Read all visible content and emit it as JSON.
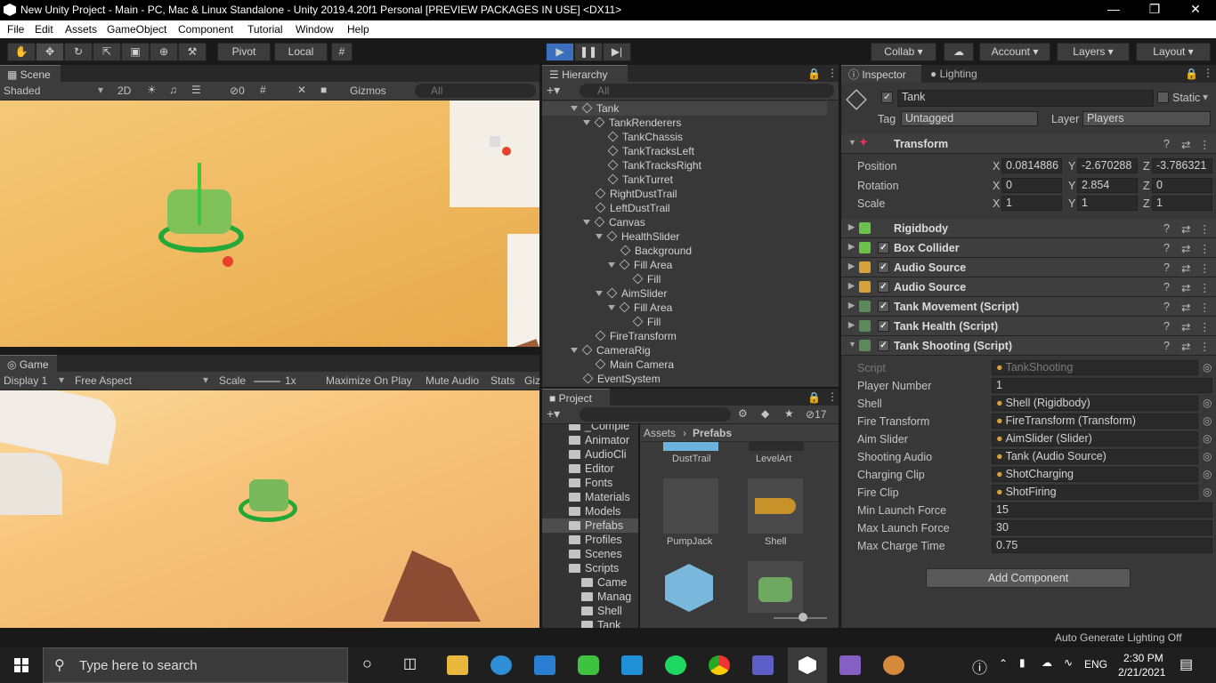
{
  "window": {
    "title": "New Unity Project - Main - PC, Mac & Linux Standalone - Unity 2019.4.20f1 Personal [PREVIEW PACKAGES IN USE] <DX11>"
  },
  "menu": [
    "File",
    "Edit",
    "Assets",
    "GameObject",
    "Component",
    "Tutorial",
    "Window",
    "Help"
  ],
  "toolbar": {
    "pivot": "Pivot",
    "local": "Local",
    "collab": "Collab",
    "account": "Account",
    "layers": "Layers",
    "layout": "Layout"
  },
  "scene": {
    "tab": "Scene",
    "shading": "Shaded",
    "mode2d": "2D",
    "hidden_count": "0",
    "gizmos": "Gizmos",
    "search_placeholder": "All"
  },
  "game": {
    "tab": "Game",
    "display": "Display 1",
    "aspect": "Free Aspect",
    "scale_label": "Scale",
    "scale_value": "1x",
    "maximize": "Maximize On Play",
    "mute": "Mute Audio",
    "stats": "Stats",
    "gizmos": "Giz"
  },
  "hierarchy": {
    "tab": "Hierarchy",
    "search_placeholder": "All",
    "items": [
      {
        "label": "Tank",
        "depth": 0,
        "expanded": true
      },
      {
        "label": "TankRenderers",
        "depth": 1,
        "expanded": true
      },
      {
        "label": "TankChassis",
        "depth": 2
      },
      {
        "label": "TankTracksLeft",
        "depth": 2
      },
      {
        "label": "TankTracksRight",
        "depth": 2
      },
      {
        "label": "TankTurret",
        "depth": 2
      },
      {
        "label": "RightDustTrail",
        "depth": 1
      },
      {
        "label": "LeftDustTrail",
        "depth": 1
      },
      {
        "label": "Canvas",
        "depth": 1,
        "expanded": true
      },
      {
        "label": "HealthSlider",
        "depth": 2,
        "expanded": true
      },
      {
        "label": "Background",
        "depth": 3
      },
      {
        "label": "Fill Area",
        "depth": 3,
        "expanded": true
      },
      {
        "label": "Fill",
        "depth": 4
      },
      {
        "label": "AimSlider",
        "depth": 2,
        "expanded": true
      },
      {
        "label": "Fill Area",
        "depth": 3,
        "expanded": true
      },
      {
        "label": "Fill",
        "depth": 4
      },
      {
        "label": "FireTransform",
        "depth": 1
      },
      {
        "label": "CameraRig",
        "depth": 0,
        "expanded": true
      },
      {
        "label": "Main Camera",
        "depth": 1
      },
      {
        "label": "EventSystem",
        "depth": 0
      }
    ]
  },
  "project": {
    "tab": "Project",
    "hidden_count": "17",
    "breadcrumb_root": "Assets",
    "breadcrumb_current": "Prefabs",
    "folders": [
      "_Comple",
      "Animator",
      "AudioCli",
      "Editor",
      "Fonts",
      "Materials",
      "Models",
      "Prefabs",
      "Profiles",
      "Scenes",
      "Scripts",
      "Came",
      "Manag",
      "Shell",
      "Tank"
    ],
    "assets": [
      "DustTrail",
      "LevelArt",
      "PumpJack",
      "Shell",
      "",
      ""
    ]
  },
  "inspector": {
    "tab": "Inspector",
    "lighting_tab": "Lighting",
    "object_name": "Tank",
    "static_label": "Static",
    "tag_label": "Tag",
    "tag_value": "Untagged",
    "layer_label": "Layer",
    "layer_value": "Players",
    "transform": {
      "title": "Transform",
      "position_label": "Position",
      "rotation_label": "Rotation",
      "scale_label": "Scale",
      "position": {
        "x": "0.0814886",
        "y": "-2.670288",
        "z": "-3.786321"
      },
      "rotation": {
        "x": "0",
        "y": "2.854",
        "z": "0"
      },
      "scale": {
        "x": "1",
        "y": "1",
        "z": "1"
      }
    },
    "components": [
      "Rigidbody",
      "Box Collider",
      "Audio Source",
      "Audio Source",
      "Tank Movement (Script)",
      "Tank Health (Script)",
      "Tank Shooting (Script)"
    ],
    "shooting": [
      {
        "label": "Script",
        "value": "TankShooting"
      },
      {
        "label": "Player Number",
        "value": "1"
      },
      {
        "label": "Shell",
        "value": "Shell (Rigidbody)"
      },
      {
        "label": "Fire Transform",
        "value": "FireTransform (Transform)"
      },
      {
        "label": "Aim Slider",
        "value": "AimSlider (Slider)"
      },
      {
        "label": "Shooting Audio",
        "value": "Tank (Audio Source)"
      },
      {
        "label": "Charging Clip",
        "value": "ShotCharging"
      },
      {
        "label": "Fire Clip",
        "value": "ShotFiring"
      },
      {
        "label": "Min Launch Force",
        "value": "15"
      },
      {
        "label": "Max Launch Force",
        "value": "30"
      },
      {
        "label": "Max Charge Time",
        "value": "0.75"
      }
    ],
    "add_component": "Add Component"
  },
  "statusbar": {
    "text": "Auto Generate Lighting Off"
  },
  "taskbar": {
    "search_placeholder": "Type here to search",
    "lang": "ENG",
    "time": "2:30 PM",
    "date": "2/21/2021"
  }
}
